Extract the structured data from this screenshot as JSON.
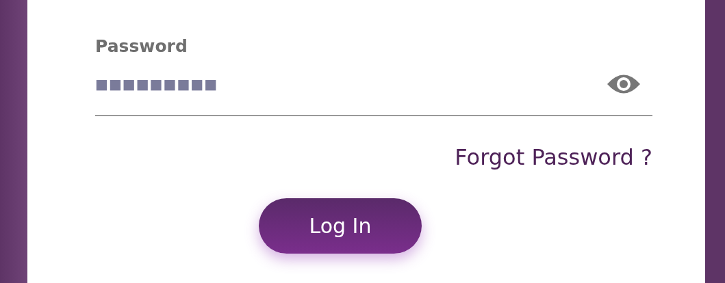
{
  "password_field": {
    "label": "Password",
    "value": "■■■■■■■■■"
  },
  "forgot_link": "Forgot Password ?",
  "login_button": "Log In"
}
